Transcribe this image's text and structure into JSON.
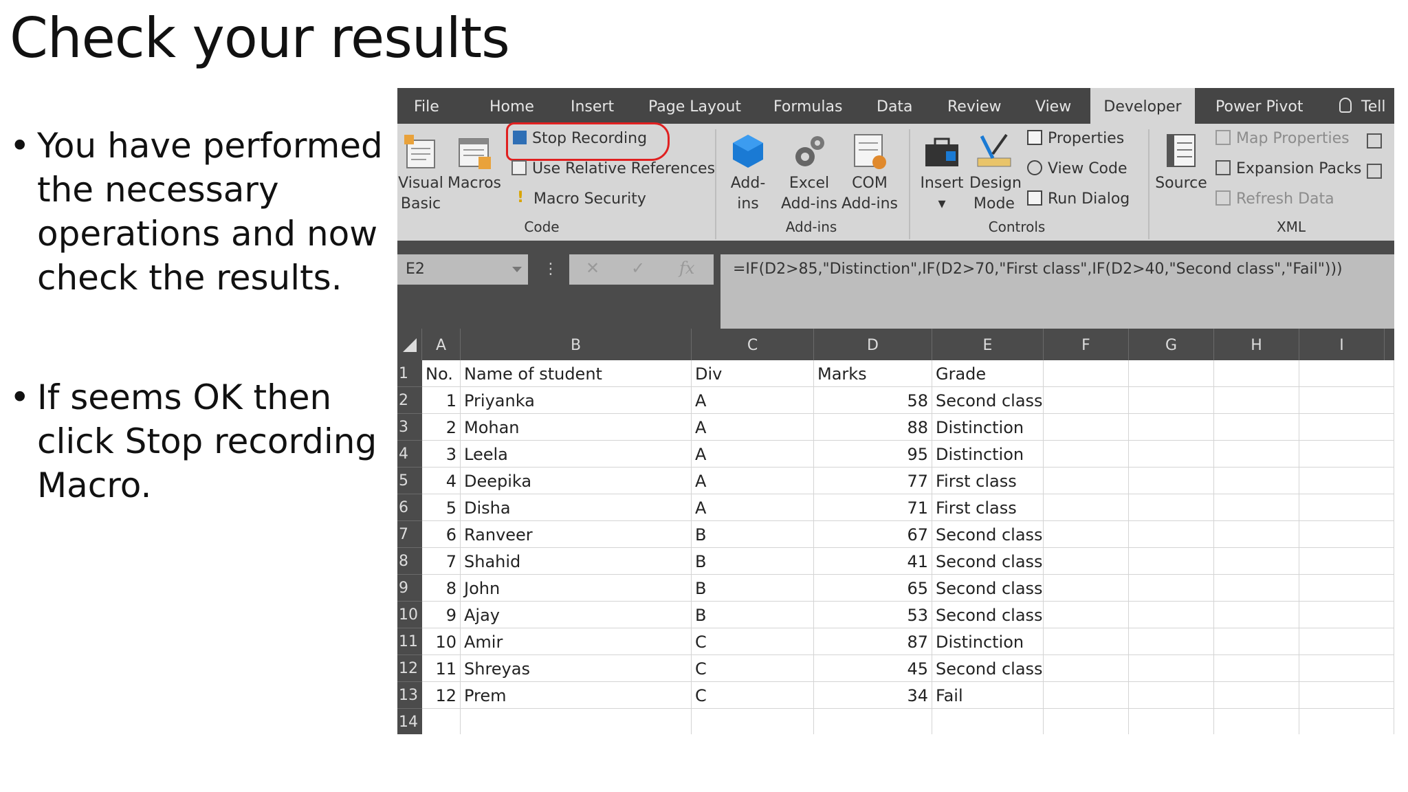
{
  "slide": {
    "title": "Check your results",
    "bullets": [
      "You have performed the necessary operations and now check the results.",
      "If seems OK then click Stop recording Macro."
    ]
  },
  "excel": {
    "tabs": [
      "File",
      "Home",
      "Insert",
      "Page Layout",
      "Formulas",
      "Data",
      "Review",
      "View",
      "Developer",
      "Power Pivot",
      "Tell"
    ],
    "active_tab": "Developer",
    "ribbon": {
      "code": {
        "label": "Code",
        "visual_basic": "Visual\nBasic",
        "macros": "Macros",
        "stop_recording": "Stop Recording",
        "relative_refs": "Use Relative References",
        "macro_security": "Macro Security"
      },
      "addins": {
        "label": "Add-ins",
        "addins": "Add-\nins",
        "excel_addins": "Excel\nAdd-ins",
        "com_addins": "COM\nAdd-ins"
      },
      "controls": {
        "label": "Controls",
        "insert": "Insert\n▾",
        "design_mode": "Design\nMode",
        "properties": "Properties",
        "view_code": "View Code",
        "run_dialog": "Run Dialog"
      },
      "xml": {
        "label": "XML",
        "source": "Source",
        "map_properties": "Map Properties",
        "expansion_packs": "Expansion Packs",
        "refresh_data": "Refresh Data"
      }
    },
    "name_box": "E2",
    "formula": "=IF(D2>85,\"Distinction\",IF(D2>70,\"First class\",IF(D2>40,\"Second class\",\"Fail\")))",
    "columns": [
      "A",
      "B",
      "C",
      "D",
      "E",
      "F",
      "G",
      "H",
      "I"
    ],
    "header_row": [
      "No.",
      "Name of student",
      "Div",
      "Marks",
      "Grade"
    ],
    "rows": [
      {
        "no": "1",
        "name": "Priyanka",
        "div": "A",
        "marks": "58",
        "grade": "Second class"
      },
      {
        "no": "2",
        "name": "Mohan",
        "div": "A",
        "marks": "88",
        "grade": "Distinction"
      },
      {
        "no": "3",
        "name": "Leela",
        "div": "A",
        "marks": "95",
        "grade": "Distinction"
      },
      {
        "no": "4",
        "name": "Deepika",
        "div": "A",
        "marks": "77",
        "grade": "First class"
      },
      {
        "no": "5",
        "name": "Disha",
        "div": "A",
        "marks": "71",
        "grade": "First class"
      },
      {
        "no": "6",
        "name": "Ranveer",
        "div": "B",
        "marks": "67",
        "grade": "Second class"
      },
      {
        "no": "7",
        "name": "Shahid",
        "div": "B",
        "marks": "41",
        "grade": "Second class"
      },
      {
        "no": "8",
        "name": "John",
        "div": "B",
        "marks": "65",
        "grade": "Second class"
      },
      {
        "no": "9",
        "name": "Ajay",
        "div": "B",
        "marks": "53",
        "grade": "Second class"
      },
      {
        "no": "10",
        "name": "Amir",
        "div": "C",
        "marks": "87",
        "grade": "Distinction"
      },
      {
        "no": "11",
        "name": "Shreyas",
        "div": "C",
        "marks": "45",
        "grade": "Second class"
      },
      {
        "no": "12",
        "name": "Prem",
        "div": "C",
        "marks": "34",
        "grade": "Fail"
      }
    ],
    "row_numbers": [
      "1",
      "2",
      "3",
      "4",
      "5",
      "6",
      "7",
      "8",
      "9",
      "10",
      "11",
      "12",
      "13",
      "14"
    ],
    "colors": {
      "tab_bar": "#454545",
      "ribbon": "#d6d6d6",
      "highlight": "#e02020",
      "stop_square": "#2f6fb5"
    }
  }
}
